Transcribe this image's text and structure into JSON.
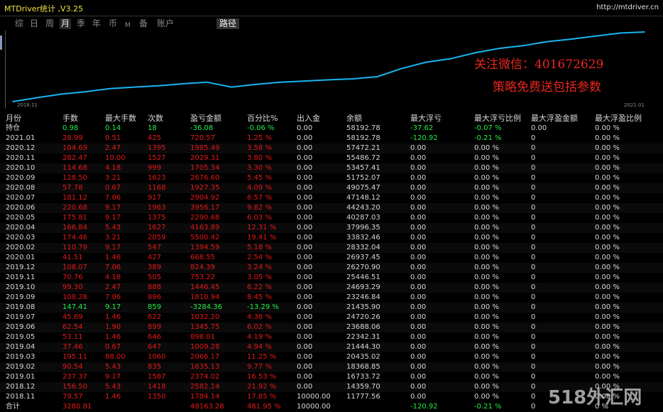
{
  "window": {
    "title": "MTDriver统计 ,V3.25",
    "url": "http://mtdriver.cn"
  },
  "tabs": [
    {
      "label": "综",
      "active": false
    },
    {
      "label": "日",
      "active": false
    },
    {
      "label": "周",
      "active": false
    },
    {
      "label": "月",
      "active": true
    },
    {
      "label": "季",
      "active": false
    },
    {
      "label": "年",
      "active": false
    },
    {
      "label": "币",
      "active": false
    },
    {
      "label": "M",
      "active": false
    },
    {
      "label": "备",
      "active": false
    },
    {
      "label": "账户",
      "active": false
    },
    {
      "label": "路径",
      "active": false
    }
  ],
  "chart_data": {
    "type": "line",
    "x": [
      "2018.11",
      "2018.12",
      "2019.01",
      "2019.02",
      "2019.03",
      "2019.04",
      "2019.05",
      "2019.06",
      "2019.07",
      "2019.08",
      "2019.09",
      "2019.10",
      "2019.11",
      "2019.12",
      "2020.01",
      "2020.02",
      "2020.03",
      "2020.04",
      "2020.05",
      "2020.06",
      "2020.07",
      "2020.08",
      "2020.09",
      "2020.10",
      "2020.11",
      "2020.12",
      "2021.01"
    ],
    "values": [
      11777.56,
      14359.7,
      16733.72,
      18368.85,
      20435.02,
      21444.3,
      22342.31,
      23688.06,
      24720.26,
      21435.9,
      23246.84,
      24693.29,
      25446.51,
      26270.9,
      26937.45,
      28332.04,
      33832.46,
      37996.35,
      40287.03,
      44243.2,
      47148.12,
      49075.47,
      51752.07,
      53457.41,
      55486.72,
      57472.21,
      58192.78
    ],
    "line_color": "#1ab3f0",
    "x_tick_labels": [
      "2018.11",
      "2021.01"
    ],
    "grid": false
  },
  "overlay": {
    "wechat": "关注微信：401672629",
    "promo": "策略免费送包括参数"
  },
  "table": {
    "headers": [
      "月份",
      "手数",
      "最大手数",
      "次数",
      "盈亏金额",
      "百分比%",
      "出入金",
      "余额",
      "最大浮亏",
      "最大浮亏比例",
      "最大浮盈金额",
      "最大浮盈比例"
    ],
    "holding": [
      "持仓",
      "0.98",
      "0.14",
      "18",
      "-36.08",
      "-0.06 %",
      "0.00",
      "58192.78",
      "-37.62",
      "-0.07 %",
      "0.00",
      "0.00 %"
    ],
    "rows": [
      [
        "2021.01",
        "28.99",
        "0.51",
        "425",
        "720.57",
        "1.25 %",
        "0.00",
        "58192.78",
        "-120.92",
        "-0.21 %",
        "0",
        "0.00 %"
      ],
      [
        "2020.12",
        "104.69",
        "2.47",
        "1395",
        "1985.49",
        "3.58 %",
        "0.00",
        "57472.21",
        "0.00",
        "0.00 %",
        "0",
        "0.00 %"
      ],
      [
        "2020.11",
        "282.47",
        "10.00",
        "1527",
        "2029.31",
        "3.80 %",
        "0.00",
        "55486.72",
        "0.00",
        "0.00 %",
        "0",
        "0.00 %"
      ],
      [
        "2020.10",
        "114.68",
        "4.18",
        "999",
        "1705.34",
        "3.30 %",
        "0.00",
        "53457.41",
        "0.00",
        "0.00 %",
        "0",
        "0.00 %"
      ],
      [
        "2020.09",
        "128.50",
        "3.21",
        "1623",
        "2676.60",
        "5.45 %",
        "0.00",
        "51752.07",
        "0.00",
        "0.00 %",
        "0",
        "0.00 %"
      ],
      [
        "2020.08",
        "57.78",
        "0.67",
        "1168",
        "1927.35",
        "4.09 %",
        "0.00",
        "49075.47",
        "0.00",
        "0.00 %",
        "0",
        "0.00 %"
      ],
      [
        "2020.07",
        "181.12",
        "7.06",
        "917",
        "2904.92",
        "6.57 %",
        "0.00",
        "47148.12",
        "0.00",
        "0.00 %",
        "0",
        "0.00 %"
      ],
      [
        "2020.06",
        "220.68",
        "9.17",
        "1963",
        "3956.17",
        "9.82 %",
        "0.00",
        "44243.20",
        "0.00",
        "0.00 %",
        "0",
        "0.00 %"
      ],
      [
        "2020.05",
        "175.81",
        "9.17",
        "1375",
        "2290.68",
        "6.03 %",
        "0.00",
        "40287.03",
        "0.00",
        "0.00 %",
        "0",
        "0.00 %"
      ],
      [
        "2020.04",
        "166.84",
        "5.43",
        "1627",
        "4163.89",
        "12.31 %",
        "0.00",
        "37996.35",
        "0.00",
        "0.00 %",
        "0",
        "0.00 %"
      ],
      [
        "2020.03",
        "174.46",
        "3.21",
        "2059",
        "5500.42",
        "19.41 %",
        "0.00",
        "33832.46",
        "0.00",
        "0.00 %",
        "0",
        "0.00 %"
      ],
      [
        "2020.02",
        "110.79",
        "9.17",
        "547",
        "1394.59",
        "5.18 %",
        "0.00",
        "28332.04",
        "0.00",
        "0.00 %",
        "0",
        "0.00 %"
      ],
      [
        "2020.01",
        "41.51",
        "1.46",
        "427",
        "668.55",
        "2.54 %",
        "0.00",
        "26937.45",
        "0.00",
        "0.00 %",
        "0",
        "0.00 %"
      ],
      [
        "2019.12",
        "108.07",
        "7.06",
        "389",
        "824.39",
        "3.24 %",
        "0.00",
        "26270.90",
        "0.00",
        "0.00 %",
        "0",
        "0.00 %"
      ],
      [
        "2019.11",
        "70.76",
        "4.18",
        "505",
        "753.22",
        "3.05 %",
        "0.00",
        "25446.51",
        "0.00",
        "0.00 %",
        "0",
        "0.00 %"
      ],
      [
        "2019.10",
        "99.30",
        "2.47",
        "888",
        "1446.45",
        "6.22 %",
        "0.00",
        "24693.29",
        "0.00",
        "0.00 %",
        "0",
        "0.00 %"
      ],
      [
        "2019.09",
        "108.28",
        "7.06",
        "896",
        "1810.94",
        "8.45 %",
        "0.00",
        "23246.84",
        "0.00",
        "0.00 %",
        "0",
        "0.00 %"
      ],
      [
        "2019.08",
        "147.41",
        "9.17",
        "859",
        "-3284.36",
        "-13.29 %",
        "0.00",
        "21435.90",
        "0.00",
        "0.00 %",
        "0",
        "0.00 %"
      ],
      [
        "2019.07",
        "45.69",
        "1.46",
        "622",
        "1032.20",
        "4.36 %",
        "0.00",
        "24720.26",
        "0.00",
        "0.00 %",
        "0",
        "0.00 %"
      ],
      [
        "2019.06",
        "62.54",
        "1.90",
        "899",
        "1345.75",
        "6.02 %",
        "0.00",
        "23688.06",
        "0.00",
        "0.00 %",
        "0",
        "0.00 %"
      ],
      [
        "2019.05",
        "53.11",
        "1.46",
        "646",
        "898.01",
        "4.19 %",
        "0.00",
        "22342.31",
        "0.00",
        "0.00 %",
        "0",
        "0.00 %"
      ],
      [
        "2019.04",
        "37.46",
        "0.67",
        "647",
        "1009.28",
        "4.94 %",
        "0.00",
        "21444.30",
        "0.00",
        "0.00 %",
        "0",
        "0.00 %"
      ],
      [
        "2019.03",
        "195.11",
        "88.00",
        "1060",
        "2066.17",
        "11.25 %",
        "0.00",
        "20435.02",
        "0.00",
        "0.00 %",
        "0",
        "0.00 %"
      ],
      [
        "2019.02",
        "90.54",
        "5.43",
        "835",
        "1635.13",
        "9.77 %",
        "0.00",
        "18368.85",
        "0.00",
        "0.00 %",
        "0",
        "0.00 %"
      ],
      [
        "2019.01",
        "237.37",
        "9.17",
        "1587",
        "2374.02",
        "16.53 %",
        "0.00",
        "16733.72",
        "0.00",
        "0.00 %",
        "0",
        "0.00 %"
      ],
      [
        "2018.12",
        "156.50",
        "5.43",
        "1418",
        "2582.14",
        "21.92 %",
        "0.00",
        "14359.70",
        "0.00",
        "0.00 %",
        "0",
        "0.00 %"
      ],
      [
        "2018.11",
        "79.57",
        "1.46",
        "1350",
        "1784.14",
        "17.85 %",
        "10000.00",
        "11777.56",
        "0.00",
        "0.00 %",
        "0",
        "0.00 %"
      ]
    ],
    "total": [
      "合计",
      "3280.81",
      "",
      "",
      "48163.28",
      "481.95 %",
      "10000.00",
      "",
      "-120.92",
      "-0.21 %",
      "0",
      "0 %"
    ]
  },
  "watermark": "518外汇网",
  "colors": {
    "positive": "#e41818",
    "negative": "#22ee44",
    "neutral": "#d8d8d8",
    "title": "#f0e040",
    "line": "#1ab3f0",
    "overlay": "#e8261e"
  }
}
